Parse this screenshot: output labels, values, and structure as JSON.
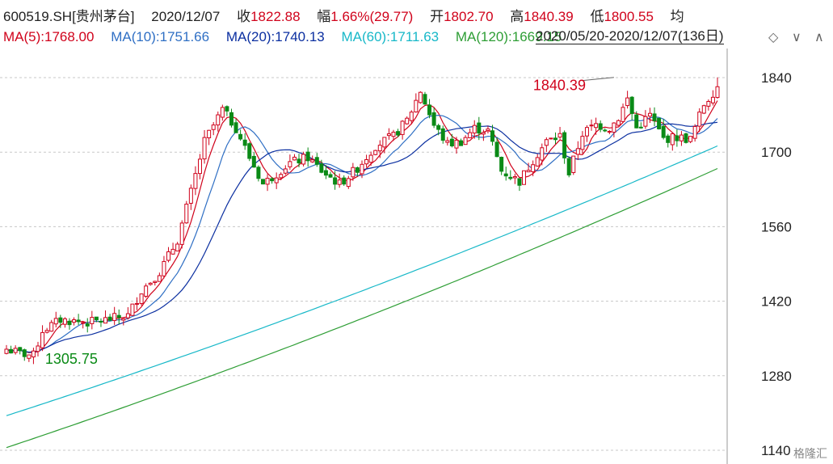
{
  "header": {
    "symbol": "600519.SH[贵州茅台]",
    "date": "2020/12/07",
    "close_label": "收",
    "close": "1822.88",
    "change_label": "幅",
    "change": "1.66%(29.77)",
    "open_label": "开",
    "open": "1802.70",
    "high_label": "高",
    "high": "1840.39",
    "low_label": "低",
    "low": "1800.55",
    "avg_label": "均"
  },
  "ma_legend": [
    {
      "text": "MA(5):1768.00",
      "color": "#d0021b"
    },
    {
      "text": "MA(10):1751.66",
      "color": "#2f6fc4"
    },
    {
      "text": "MA(20):1740.13",
      "color": "#0b2fa0"
    },
    {
      "text": "MA(60):1711.63",
      "color": "#17b8c8"
    },
    {
      "text": "MA(120):1669.15",
      "color": "#2e9e35"
    }
  ],
  "range_label": "2020/05/20-2020/12/07(136日)",
  "controls": {
    "settings": "◇",
    "collapse": "∨",
    "expand": "∧"
  },
  "watermark": "格隆汇",
  "colors": {
    "up": "#d0021b",
    "down": "#0a8a16",
    "bg": "#ffffff",
    "grid": "#c8c8c8"
  },
  "chart_data": {
    "type": "candlestick",
    "x_range": [
      "2020/05/20",
      "2020/12/07"
    ],
    "trading_days": 136,
    "y_ticks": [
      1840,
      1700,
      1560,
      1420,
      1280,
      1140
    ],
    "ylim": [
      1130,
      1865
    ],
    "annotations": [
      {
        "text": "1840.39",
        "type": "high",
        "index": 135,
        "value": 1840.39,
        "color": "#d0021b"
      },
      {
        "text": "1305.75",
        "type": "low",
        "index": 5,
        "value": 1305.75,
        "color": "#0a8a16"
      }
    ],
    "close_anchors": [
      [
        0,
        1330
      ],
      [
        3,
        1322
      ],
      [
        6,
        1318
      ],
      [
        8,
        1365
      ],
      [
        12,
        1385
      ],
      [
        18,
        1380
      ],
      [
        22,
        1385
      ],
      [
        27,
        1393
      ],
      [
        30,
        1440
      ],
      [
        34,
        1475
      ],
      [
        38,
        1535
      ],
      [
        41,
        1625
      ],
      [
        44,
        1720
      ],
      [
        48,
        1780
      ],
      [
        51,
        1745
      ],
      [
        54,
        1690
      ],
      [
        57,
        1640
      ],
      [
        60,
        1660
      ],
      [
        63,
        1680
      ],
      [
        67,
        1690
      ],
      [
        70,
        1665
      ],
      [
        74,
        1640
      ],
      [
        78,
        1670
      ],
      [
        82,
        1712
      ],
      [
        86,
        1730
      ],
      [
        89,
        1760
      ],
      [
        92,
        1815
      ],
      [
        95,
        1750
      ],
      [
        98,
        1715
      ],
      [
        101,
        1720
      ],
      [
        104,
        1745
      ],
      [
        107,
        1740
      ],
      [
        110,
        1665
      ],
      [
        114,
        1645
      ],
      [
        117,
        1685
      ],
      [
        120,
        1720
      ],
      [
        123,
        1730
      ],
      [
        125,
        1660
      ],
      [
        128,
        1735
      ],
      [
        131,
        1752
      ],
      [
        134,
        1745
      ],
      [
        136,
        1765
      ],
      [
        138,
        1800
      ],
      [
        140,
        1745
      ],
      [
        143,
        1770
      ],
      [
        146,
        1725
      ],
      [
        149,
        1728
      ],
      [
        152,
        1724
      ],
      [
        155,
        1790
      ],
      [
        158,
        1823
      ]
    ],
    "candle_count": 159,
    "ma_series": [
      {
        "name": "MA(5)",
        "last": 1768.0,
        "window": 5
      },
      {
        "name": "MA(10)",
        "last": 1751.66,
        "window": 10
      },
      {
        "name": "MA(20)",
        "last": 1740.13,
        "window": 20
      },
      {
        "name": "MA(60)",
        "last": 1711.63,
        "start": 1205,
        "end": 1711.63
      },
      {
        "name": "MA(120)",
        "last": 1669.15,
        "start": 1145,
        "end": 1669.15
      }
    ]
  }
}
